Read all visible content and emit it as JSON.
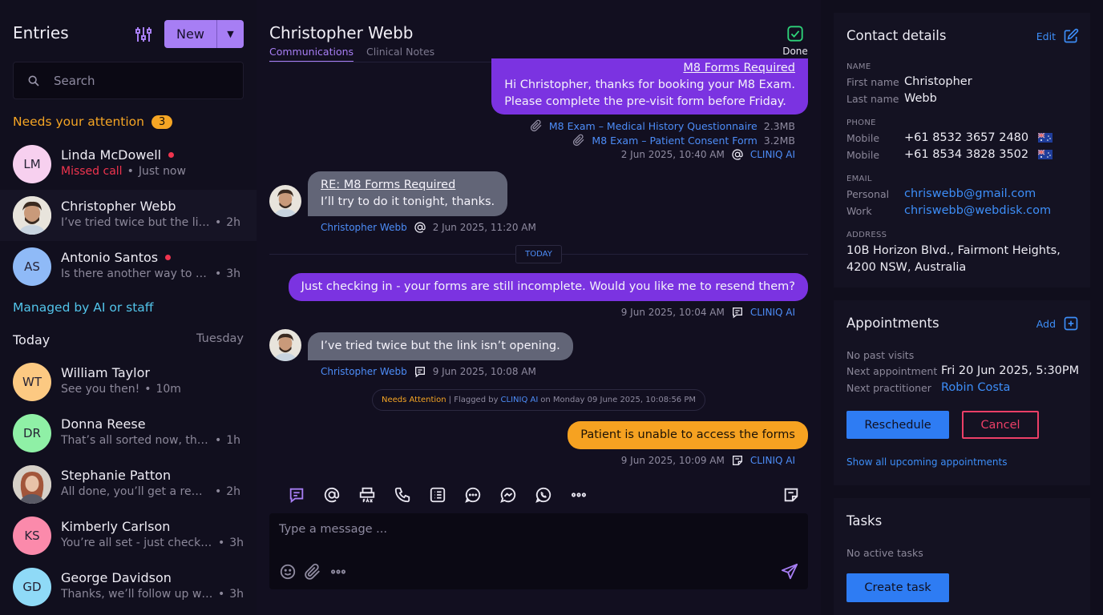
{
  "sidebar": {
    "title": "Entries",
    "new_label": "New",
    "search_placeholder": "Search",
    "attention_label": "Needs your attention",
    "attention_count": "3",
    "attention_items": [
      {
        "initials": "LM",
        "name": "Linda McDowell",
        "status": "Missed call",
        "time": "Just now",
        "unread": true,
        "color": "#f7d0ef"
      },
      {
        "initials": "",
        "name": "Christopher Webb",
        "preview": "I’ve tried twice but the link isn’t opening.",
        "time": "2h",
        "unread": false,
        "selected": true
      },
      {
        "initials": "AS",
        "name": "Antonio Santos",
        "preview": "Is there another way to submit the forms?",
        "time": "3h",
        "unread": true,
        "color": "#8fbaf7"
      }
    ],
    "managed_label": "Managed by AI or staff",
    "today_label": "Today",
    "day_label": "Tuesday",
    "managed_items": [
      {
        "initials": "WT",
        "name": "William Taylor",
        "preview": "See you then!",
        "time": "10m",
        "color": "#fcc982"
      },
      {
        "initials": "DR",
        "name": "Donna Reese",
        "preview": "That’s all sorted now, thank you.",
        "time": "1h",
        "color": "#8ff0a6"
      },
      {
        "initials": "",
        "name": "Stephanie Patton",
        "preview": "All done, you’ll get a reminder soon.",
        "time": "2h"
      },
      {
        "initials": "KS",
        "name": "Kimberly Carlson",
        "preview": "You’re all set - just check in at reception.",
        "time": "3h",
        "color": "#fb8aab"
      },
      {
        "initials": "GD",
        "name": "George Davidson",
        "preview": "Thanks, we’ll follow up with you shortly.",
        "time": "3h",
        "color": "#8fdaf7"
      }
    ]
  },
  "conversation": {
    "name": "Christopher Webb",
    "tabs": [
      "Communications",
      "Clinical Notes"
    ],
    "done_label": "Done",
    "msg1": {
      "subject": "M8 Forms Required",
      "line1": "Hi Christopher, thanks for booking your M8 Exam.",
      "line2": "Please complete the pre-visit form before Friday."
    },
    "attachments": [
      {
        "name": "M8 Exam – Medical History Questionnaire",
        "size": "2.3MB"
      },
      {
        "name": "M8 Exam – Patient Consent Form",
        "size": "3.2MB"
      }
    ],
    "msg1_meta": {
      "time": "2 Jun 2025, 10:40 AM",
      "sender": "CLINIQ AI"
    },
    "msg2": {
      "subject": "RE: M8 Forms Required",
      "text": "I’ll try to do it tonight, thanks."
    },
    "msg2_meta": {
      "sender": "Christopher Webb",
      "time": "2 Jun 2025, 11:20 AM"
    },
    "today_divider": "TODAY",
    "msg3": {
      "text": "Just checking in - your forms are still incomplete. Would you like me to resend them?"
    },
    "msg3_meta": {
      "time": "9 Jun 2025, 10:04 AM",
      "sender": "CLINIQ AI"
    },
    "msg4": {
      "text": "I’ve tried twice but the link isn’t opening."
    },
    "msg4_meta": {
      "sender": "Christopher Webb",
      "time": "9 Jun 2025, 10:08 AM"
    },
    "flag_note": {
      "status": "Needs Attention",
      "separator": "| Flagged by",
      "by": "CLINIQ AI",
      "on": "on Monday 09 June 2025, 10:08:56 PM"
    },
    "note": {
      "text": "Patient is unable to access the forms"
    },
    "note_meta": {
      "time": "9 Jun 2025, 10:09 AM",
      "sender": "CLINIQ AI"
    },
    "composer_placeholder": "Type a message ..."
  },
  "contact": {
    "title": "Contact details",
    "edit_label": "Edit",
    "name_head": "NAME",
    "first_name_label": "First name",
    "first_name": "Christopher",
    "last_name_label": "Last name",
    "last_name": "Webb",
    "phone_head": "PHONE",
    "phones": [
      {
        "label": "Mobile",
        "number": "+61 8532 3657 2480"
      },
      {
        "label": "Mobile",
        "number": "+61 8534 3828 3502"
      }
    ],
    "email_head": "EMAIL",
    "emails": [
      {
        "label": "Personal",
        "address": "chriswebb@gmail.com"
      },
      {
        "label": "Work",
        "address": "chriswebb@webdisk.com"
      }
    ],
    "address_head": "ADDRESS",
    "address_line1": "10B Horizon Blvd., Fairmont Heights,",
    "address_line2": "4200 NSW, Australia"
  },
  "appointments": {
    "title": "Appointments",
    "add_label": "Add",
    "past_visits": "No past visits",
    "next_label": "Next appointment",
    "next_value": "Fri 20 Jun 2025, 5:30PM",
    "practitioner_label": "Next practitioner",
    "practitioner": "Robin Costa",
    "reschedule_label": "Reschedule",
    "cancel_label": "Cancel",
    "show_all_label": "Show all upcoming appointments"
  },
  "tasks": {
    "title": "Tasks",
    "empty_label": "No active tasks",
    "create_label": "Create task"
  },
  "colors": {
    "accent": "#a77ef4",
    "outgoing": "#7b33e1",
    "incoming": "#626577",
    "attention": "#f5a524",
    "link": "#3d8ef8",
    "danger": "#ec3f67"
  }
}
